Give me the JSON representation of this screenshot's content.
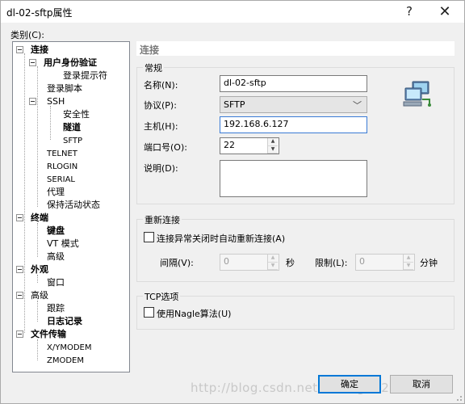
{
  "window": {
    "title": "dl-02-sftp属性",
    "help_glyph": "?",
    "close_glyph": "✕"
  },
  "category_label": "类别(C):",
  "tree": {
    "connection": "连接",
    "user_auth": "用户身份验证",
    "login_prompt": "登录提示符",
    "login_script": "登录脚本",
    "ssh": "SSH",
    "security": "安全性",
    "tunnel": "隧道",
    "sftp": "SFTP",
    "telnet": "TELNET",
    "rlogin": "RLOGIN",
    "serial": "SERIAL",
    "proxy": "代理",
    "keepalive": "保持活动状态",
    "terminal": "终端",
    "keyboard": "键盘",
    "vt_mode": "VT 模式",
    "advanced_t": "高级",
    "appearance": "外观",
    "window_item": "窗口",
    "advanced": "高级",
    "trace": "跟踪",
    "logging": "日志记录",
    "file_transfer": "文件传输",
    "xymodem": "X/YMODEM",
    "zmodem": "ZMODEM"
  },
  "panel_header": "连接",
  "general": {
    "group": "常规",
    "name_label": "名称(N):",
    "name_value": "dl-02-sftp",
    "protocol_label": "协议(P):",
    "protocol_value": "SFTP",
    "host_label": "主机(H):",
    "host_value": "192.168.6.127",
    "port_label": "端口号(O):",
    "port_value": "22",
    "desc_label": "说明(D):",
    "desc_value": ""
  },
  "reconnect": {
    "group": "重新连接",
    "checkbox_label": "连接异常关闭时自动重新连接(A)",
    "interval_label": "间隔(V):",
    "interval_value": "0",
    "seconds_unit": "秒",
    "limit_label": "限制(L):",
    "limit_value": "0",
    "minutes_unit": "分钟"
  },
  "tcp": {
    "group": "TCP选项",
    "nagle_label": "使用Nagle算法(U)"
  },
  "buttons": {
    "ok": "确定",
    "cancel": "取消"
  },
  "watermark": "http://blog.csdn.net/sbbing1124"
}
